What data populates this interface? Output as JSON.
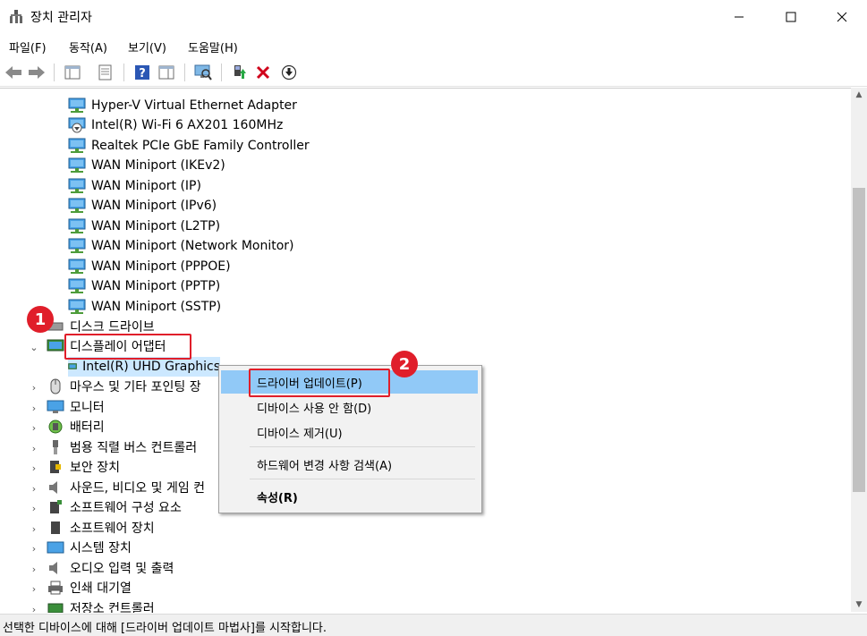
{
  "window": {
    "title": "장치 관리자",
    "minimize_label": "—",
    "maximize_label": "☐",
    "close_label": "✕"
  },
  "menu": {
    "items": [
      "파일(F)",
      "동작(A)",
      "보기(V)",
      "도움말(H)"
    ]
  },
  "tree": {
    "network_children": [
      "Hyper-V Virtual Ethernet Adapter",
      "Intel(R) Wi-Fi 6 AX201 160MHz",
      "Realtek PCIe GbE Family Controller",
      "WAN Miniport (IKEv2)",
      "WAN Miniport (IP)",
      "WAN Miniport (IPv6)",
      "WAN Miniport (L2TP)",
      "WAN Miniport (Network Monitor)",
      "WAN Miniport (PPPOE)",
      "WAN Miniport (PPTP)",
      "WAN Miniport (SSTP)"
    ],
    "disk_drives": "디스크 드라이브",
    "display_adapters": "디스플레이 어댑터",
    "display_child": "Intel(R) UHD Graphics",
    "categories": [
      "마우스 및 기타 포인팅 장",
      "모니터",
      "배터리",
      "범용 직렬 버스 컨트롤러",
      "보안 장치",
      "사운드, 비디오 및 게임 컨",
      "소프트웨어 구성 요소",
      "소프트웨어 장치",
      "시스템 장치",
      "오디오 입력 및 출력",
      "인쇄 대기열",
      "저장소 컨트롤러"
    ]
  },
  "context_menu": {
    "update_driver": "드라이버 업데이트(P)",
    "disable_device": "디바이스 사용 안 함(D)",
    "uninstall_device": "디바이스 제거(U)",
    "scan_hardware": "하드웨어 변경 사항 검색(A)",
    "properties": "속성(R)"
  },
  "annotations": {
    "badge1": "1",
    "badge2": "2"
  },
  "status": {
    "text": "선택한 디바이스에 대해 [드라이버 업데이트 마법사]를 시작합니다."
  },
  "colors": {
    "highlight": "#91c9f7",
    "annotation_red": "#e01e2a"
  }
}
